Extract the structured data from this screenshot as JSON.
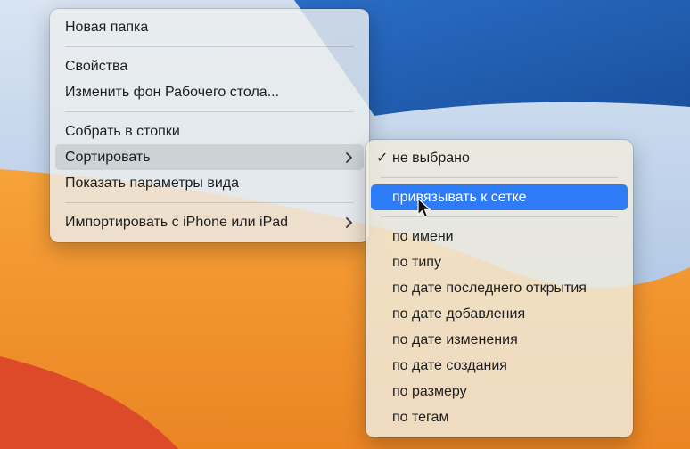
{
  "colors": {
    "wallpaper_blue": "#1f5fb5",
    "wallpaper_light": "#b9cde8",
    "wallpaper_orange": "#f0902a",
    "wallpaper_red": "#dc4a2a",
    "highlight": "#2e7bf6"
  },
  "context_menu": {
    "items": [
      {
        "label": "Новая папка"
      },
      {
        "label": "Свойства"
      },
      {
        "label": "Изменить фон Рабочего стола..."
      },
      {
        "label": "Собрать в стопки"
      },
      {
        "label": "Сортировать"
      },
      {
        "label": "Показать параметры вида"
      },
      {
        "label": "Импортировать с iPhone или iPad"
      }
    ]
  },
  "submenu": {
    "checked_glyph": "✓",
    "items": [
      {
        "label": "не выбрано",
        "checked": true
      },
      {
        "label": "привязывать к сетке"
      },
      {
        "label": "по имени"
      },
      {
        "label": "по типу"
      },
      {
        "label": "по дате последнего открытия"
      },
      {
        "label": "по дате добавления"
      },
      {
        "label": "по дате изменения"
      },
      {
        "label": "по дате создания"
      },
      {
        "label": "по размеру"
      },
      {
        "label": "по тегам"
      }
    ]
  },
  "icons": {
    "chevron": "chevron-right-icon",
    "checkmark": "checkmark-icon",
    "cursor": "mouse-pointer-icon"
  }
}
